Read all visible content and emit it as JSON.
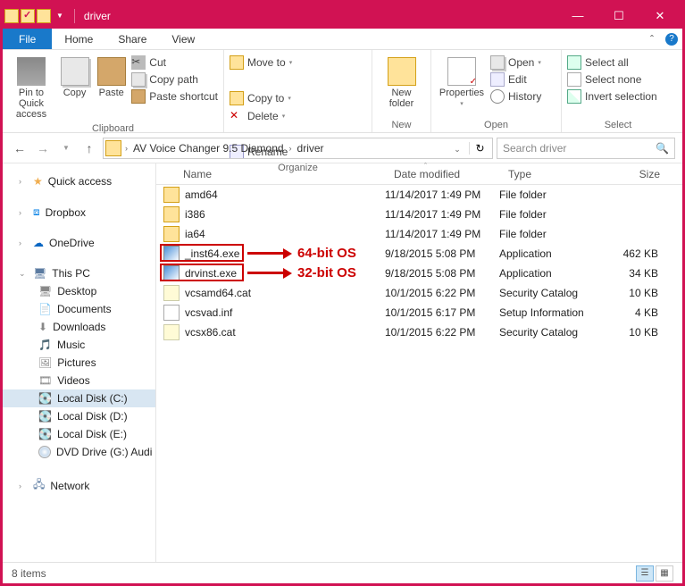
{
  "window": {
    "title": "driver"
  },
  "tabs": {
    "file": "File",
    "home": "Home",
    "share": "Share",
    "view": "View"
  },
  "ribbon": {
    "clipboard": {
      "label": "Clipboard",
      "pin": "Pin to Quick\naccess",
      "copy": "Copy",
      "paste": "Paste",
      "cut": "Cut",
      "copypath": "Copy path",
      "shortcut": "Paste shortcut"
    },
    "organize": {
      "label": "Organize",
      "moveto": "Move to",
      "copyto": "Copy to",
      "delete": "Delete",
      "rename": "Rename"
    },
    "new": {
      "label": "New",
      "newfolder": "New\nfolder"
    },
    "open": {
      "label": "Open",
      "properties": "Properties",
      "open": "Open",
      "edit": "Edit",
      "history": "History"
    },
    "select": {
      "label": "Select",
      "all": "Select all",
      "none": "Select none",
      "invert": "Invert selection"
    }
  },
  "address": {
    "crumbs": [
      "AV Voice Changer 9.5 Diamond",
      "driver"
    ],
    "search_placeholder": "Search driver"
  },
  "sidebar": {
    "quick": "Quick access",
    "dropbox": "Dropbox",
    "onedrive": "OneDrive",
    "thispc": "This PC",
    "items": [
      "Desktop",
      "Documents",
      "Downloads",
      "Music",
      "Pictures",
      "Videos",
      "Local Disk (C:)",
      "Local Disk (D:)",
      "Local Disk (E:)",
      "DVD Drive (G:) Audi"
    ],
    "network": "Network"
  },
  "columns": {
    "name": "Name",
    "date": "Date modified",
    "type": "Type",
    "size": "Size"
  },
  "rows": [
    {
      "icon": "folder",
      "name": "amd64",
      "date": "11/14/2017 1:49 PM",
      "type": "File folder",
      "size": ""
    },
    {
      "icon": "folder",
      "name": "i386",
      "date": "11/14/2017 1:49 PM",
      "type": "File folder",
      "size": ""
    },
    {
      "icon": "folder",
      "name": "ia64",
      "date": "11/14/2017 1:49 PM",
      "type": "File folder",
      "size": ""
    },
    {
      "icon": "exe",
      "name": "_inst64.exe",
      "date": "9/18/2015 5:08 PM",
      "type": "Application",
      "size": "462 KB"
    },
    {
      "icon": "exe",
      "name": "drvinst.exe",
      "date": "9/18/2015 5:08 PM",
      "type": "Application",
      "size": "34 KB"
    },
    {
      "icon": "cat",
      "name": "vcsamd64.cat",
      "date": "10/1/2015 6:22 PM",
      "type": "Security Catalog",
      "size": "10 KB"
    },
    {
      "icon": "inf",
      "name": "vcsvad.inf",
      "date": "10/1/2015 6:17 PM",
      "type": "Setup Information",
      "size": "4 KB"
    },
    {
      "icon": "cat",
      "name": "vcsx86.cat",
      "date": "10/1/2015 6:22 PM",
      "type": "Security Catalog",
      "size": "10 KB"
    }
  ],
  "callouts": {
    "c64": "64-bit OS",
    "c32": "32-bit OS"
  },
  "status": {
    "count": "8 items"
  }
}
